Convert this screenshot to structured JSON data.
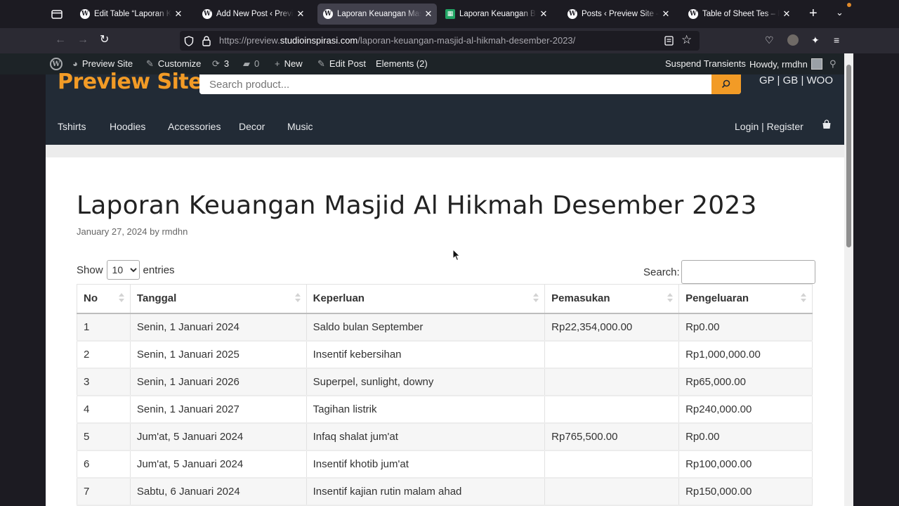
{
  "browser": {
    "tabs": [
      {
        "title": "Edit Table “Laporan Keuangan",
        "icon": "wordpress-icon",
        "active": false
      },
      {
        "title": "Add New Post ‹ Preview Site",
        "icon": "wordpress-icon",
        "active": false
      },
      {
        "title": "Laporan Keuangan Masjid Al Hikmah",
        "icon": "wordpress-icon",
        "active": true
      },
      {
        "title": "Laporan Keuangan Bulanan",
        "icon": "sheets-icon",
        "active": false
      },
      {
        "title": "Posts ‹ Preview Site — WordPress",
        "icon": "wordpress-icon",
        "active": false
      },
      {
        "title": "Table of Sheet Tes – Preview",
        "icon": "wordpress-icon",
        "active": false
      }
    ],
    "url_prefix": "https://preview.",
    "url_host": "studioinspirasi.com",
    "url_path": "/laporan-keuangan-masjid-al-hikmah-desember-2023/"
  },
  "adminbar": {
    "site_name": "Preview Site",
    "customize": "Customize",
    "updates_count": "3",
    "comments_count": "0",
    "new": "New",
    "edit_post": "Edit Post",
    "elements": "Elements (2)",
    "suspend": "Suspend Transients",
    "howdy": "Howdy, rmdhn"
  },
  "site": {
    "title": "Preview Site",
    "search_placeholder": "Search product...",
    "header_links": "GP | GB | WOO",
    "menu": [
      "Tshirts",
      "Hoodies",
      "Accessories",
      "Decor",
      "Music"
    ],
    "account": "Login | Register"
  },
  "post": {
    "title": "Laporan Keuangan Masjid Al Hikmah Desember 2023",
    "date": "January 27, 2024",
    "by": "by",
    "author": "rmdhn"
  },
  "datatable": {
    "show_label": "Show",
    "page_length": "10",
    "entries_label": "entries",
    "search_label": "Search:",
    "columns": [
      "No",
      "Tanggal",
      "Keperluan",
      "Pemasukan",
      "Pengeluaran"
    ],
    "rows": [
      [
        "1",
        "Senin, 1 Januari 2024",
        "Saldo bulan September",
        "Rp22,354,000.00",
        "Rp0.00"
      ],
      [
        "2",
        "Senin, 1 Januari 2025",
        "Insentif kebersihan",
        "",
        "Rp1,000,000.00"
      ],
      [
        "3",
        "Senin, 1 Januari 2026",
        "Superpel, sunlight, downy",
        "",
        "Rp65,000.00"
      ],
      [
        "4",
        "Senin, 1 Januari 2027",
        "Tagihan listrik",
        "",
        "Rp240,000.00"
      ],
      [
        "5",
        "Jum'at, 5 Januari 2024",
        "Infaq shalat jum'at",
        "Rp765,500.00",
        "Rp0.00"
      ],
      [
        "6",
        "Jum'at, 5 Januari 2024",
        "Insentif khotib jum'at",
        "",
        "Rp100,000.00"
      ],
      [
        "7",
        "Sabtu, 6 Januari 2024",
        "Insentif kajian rutin malam ahad",
        "",
        "Rp150,000.00"
      ]
    ]
  },
  "colors": {
    "accent": "#f29b26",
    "header_bg": "#222b36",
    "adminbar_bg": "#1d2327"
  }
}
